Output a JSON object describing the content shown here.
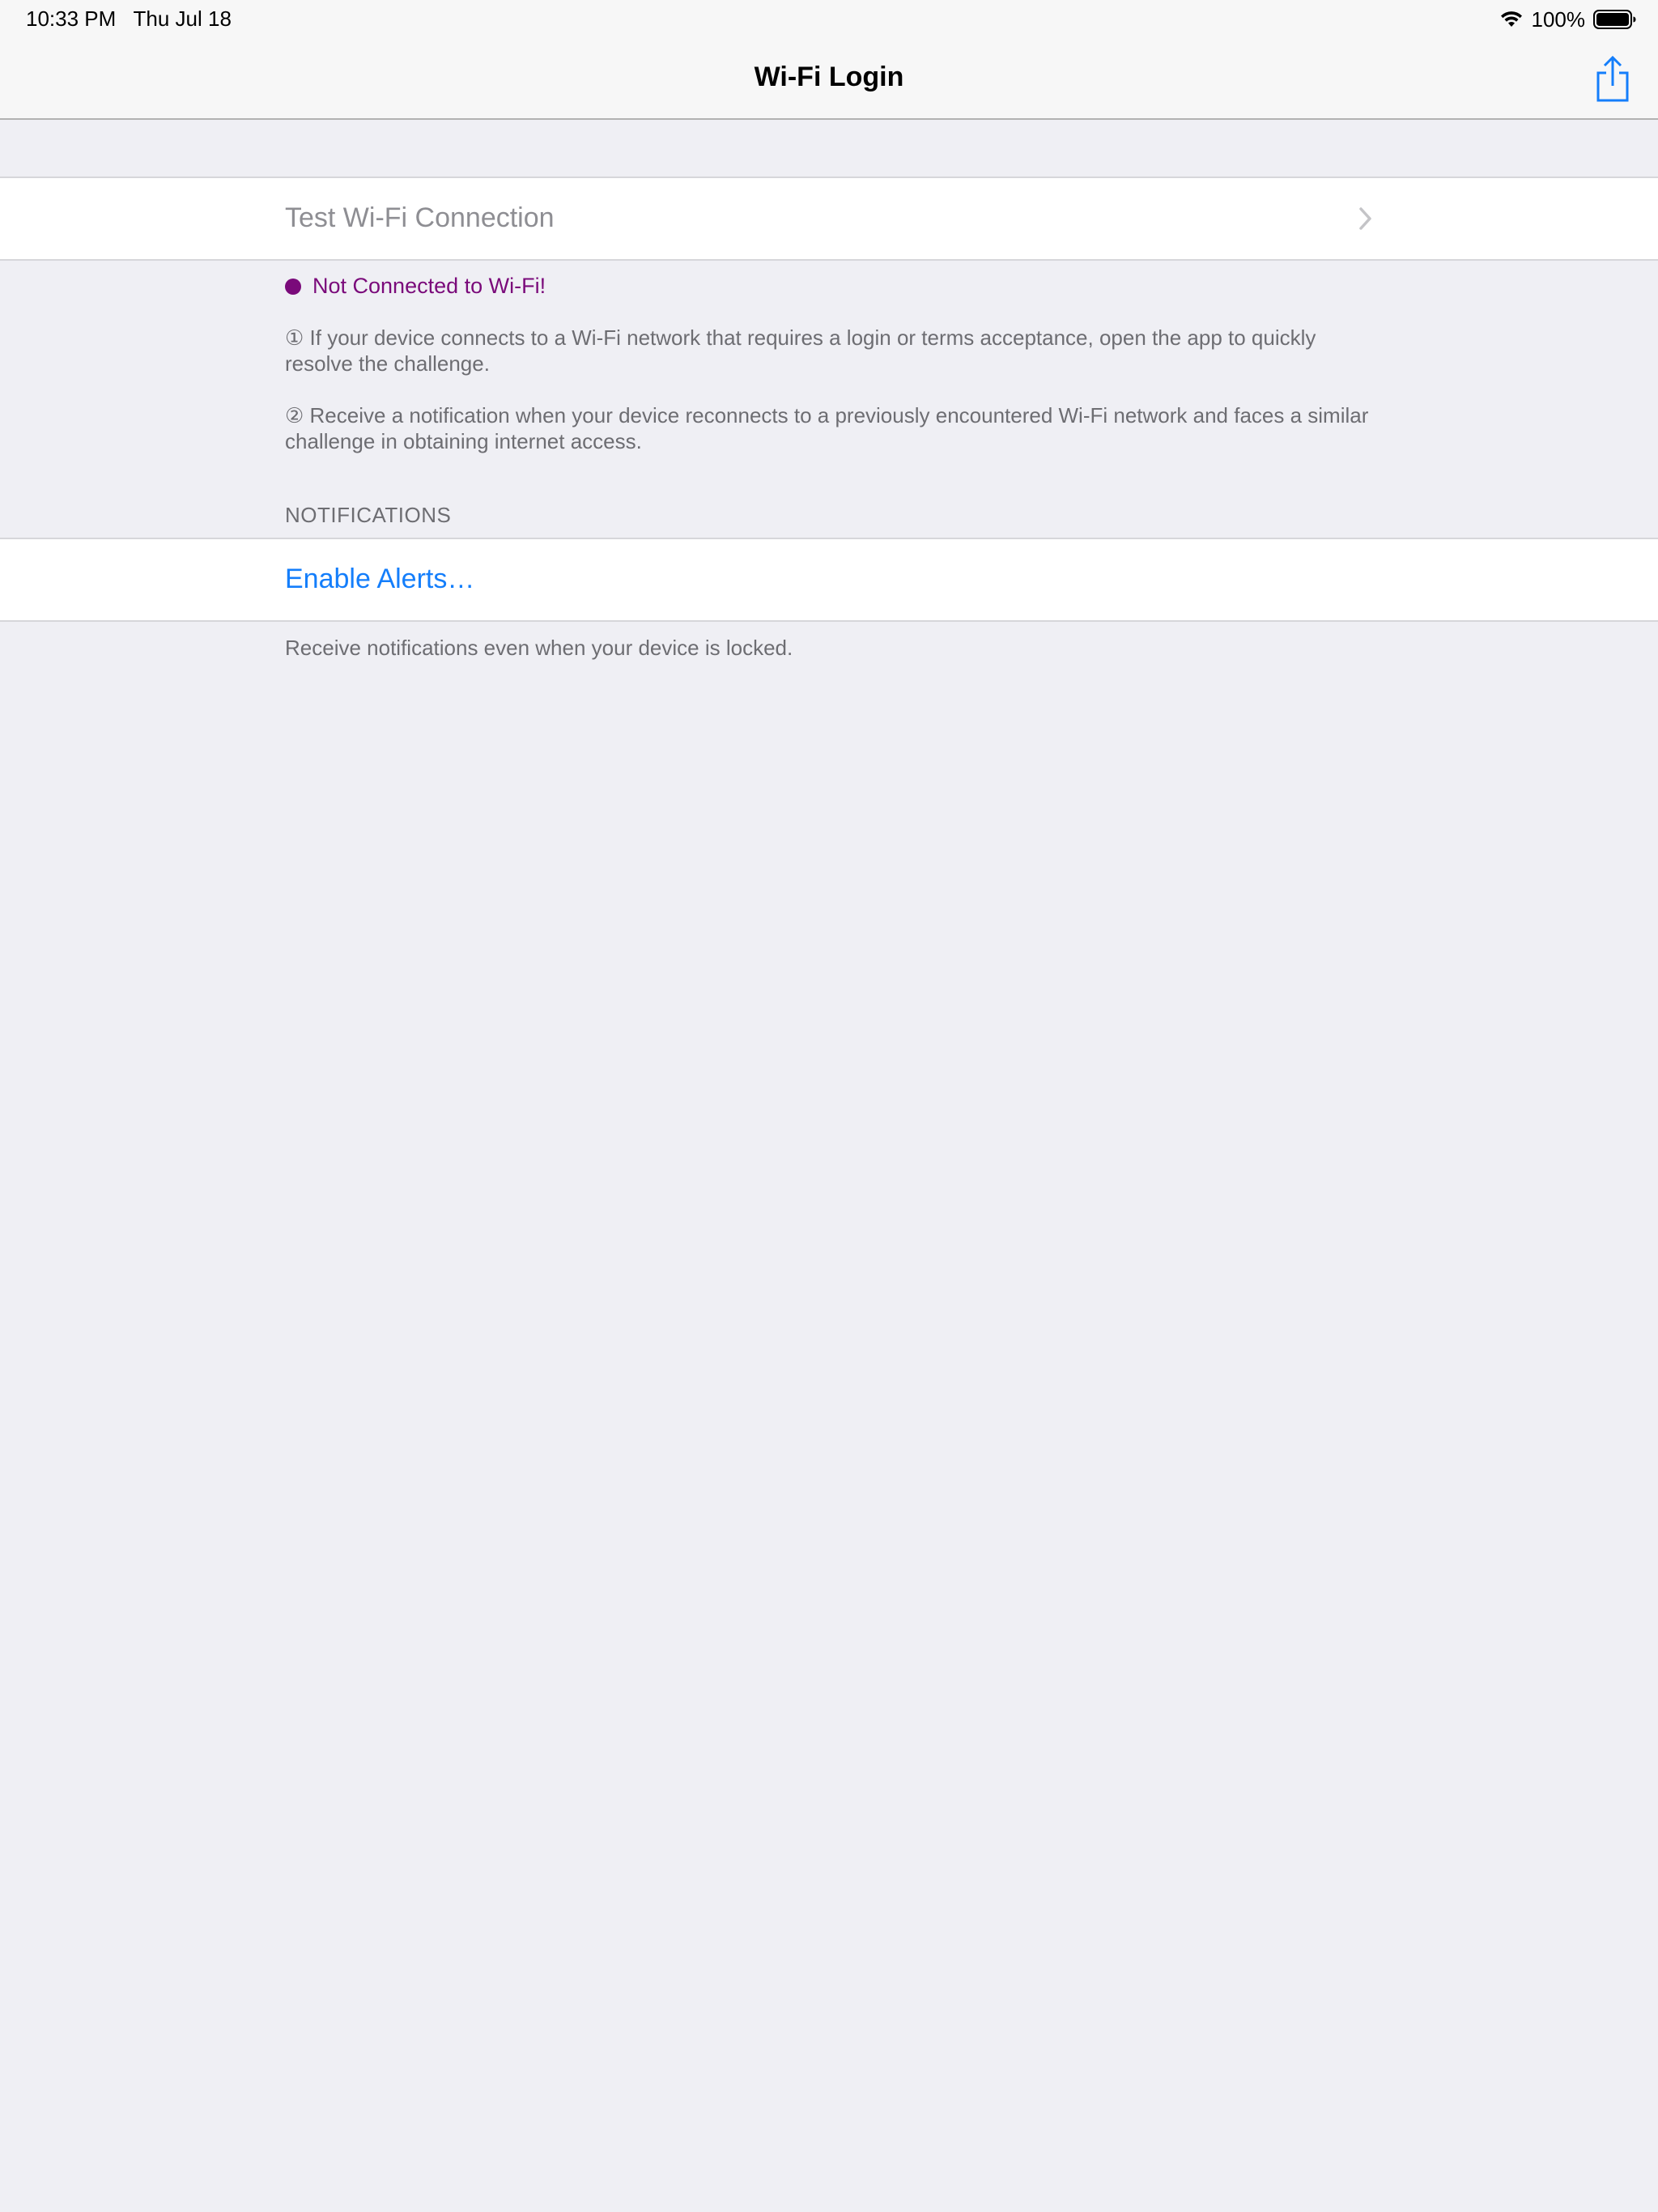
{
  "status_bar": {
    "time": "10:33 PM",
    "date": "Thu Jul 18",
    "battery": "100%"
  },
  "nav": {
    "title": "Wi-Fi Login"
  },
  "test_cell": {
    "label": "Test Wi-Fi Connection"
  },
  "connection_status": {
    "text": "Not Connected to Wi-Fi!",
    "color": "#7a0a7a"
  },
  "info": {
    "item1": "① If your device connects to a Wi-Fi network that requires a login or terms acceptance, open the app to quickly resolve the challenge.",
    "item2": "② Receive a notification when your device reconnects to a previously encountered Wi-Fi network and faces a similar challenge in obtaining internet access."
  },
  "notifications": {
    "header": "NOTIFICATIONS",
    "enable_label": "Enable Alerts…",
    "footer": "Receive notifications even when your device is locked."
  },
  "colors": {
    "accent": "#147efb",
    "background": "#efeff4"
  },
  "icons": {
    "wifi": "wifi-icon",
    "battery": "battery-icon",
    "share": "share-icon",
    "chevron": "chevron-right-icon"
  }
}
